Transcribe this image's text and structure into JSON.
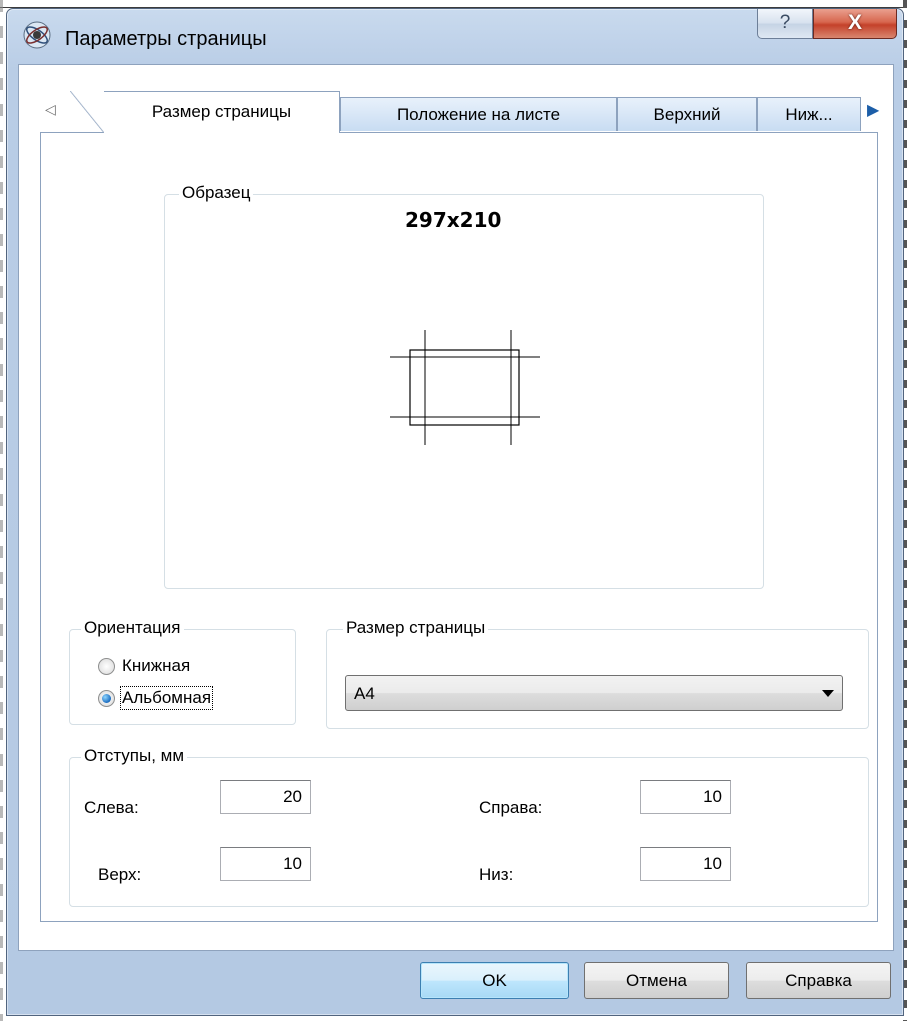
{
  "window": {
    "title": "Параметры страницы",
    "help_label": "?",
    "close_label": "X"
  },
  "tabs": {
    "scroll_left_icon": "tab-scroll-left-icon",
    "scroll_right_icon": "tab-scroll-right-icon",
    "items": [
      {
        "label": "Размер страницы",
        "active": true
      },
      {
        "label": "Положение на листе",
        "active": false
      },
      {
        "label": "Верхний",
        "active": false
      },
      {
        "label": "Ниж...",
        "active": false
      }
    ]
  },
  "sample": {
    "group_label": "Образец",
    "dimensions": "297x210"
  },
  "orientation": {
    "group_label": "Ориентация",
    "options": [
      {
        "label": "Книжная",
        "checked": false
      },
      {
        "label": "Альбомная",
        "checked": true
      }
    ]
  },
  "page_size": {
    "group_label": "Размер страницы",
    "selected": "A4"
  },
  "margins": {
    "group_label": "Отступы, мм",
    "left_label": "Слева:",
    "left_value": "20",
    "right_label": "Справа:",
    "right_value": "10",
    "top_label": "Верх:",
    "top_value": "10",
    "bottom_label": "Низ:",
    "bottom_value": "10"
  },
  "buttons": {
    "ok": "OK",
    "cancel": "Отмена",
    "help": "Справка"
  },
  "colors": {
    "frame": "#b9cde6",
    "close": "#c4412a",
    "default_button": "#bee6fd"
  }
}
